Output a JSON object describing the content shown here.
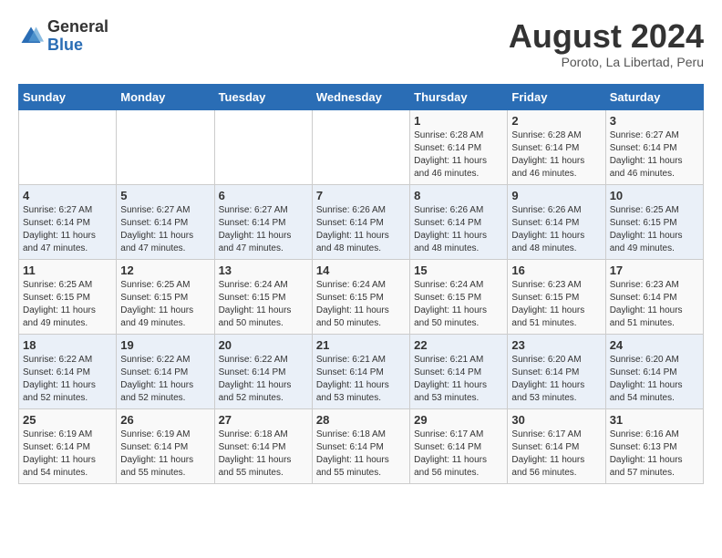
{
  "logo": {
    "text_general": "General",
    "text_blue": "Blue"
  },
  "title": "August 2024",
  "subtitle": "Poroto, La Libertad, Peru",
  "days_of_week": [
    "Sunday",
    "Monday",
    "Tuesday",
    "Wednesday",
    "Thursday",
    "Friday",
    "Saturday"
  ],
  "weeks": [
    [
      {
        "day": "",
        "info": ""
      },
      {
        "day": "",
        "info": ""
      },
      {
        "day": "",
        "info": ""
      },
      {
        "day": "",
        "info": ""
      },
      {
        "day": "1",
        "info": "Sunrise: 6:28 AM\nSunset: 6:14 PM\nDaylight: 11 hours\nand 46 minutes."
      },
      {
        "day": "2",
        "info": "Sunrise: 6:28 AM\nSunset: 6:14 PM\nDaylight: 11 hours\nand 46 minutes."
      },
      {
        "day": "3",
        "info": "Sunrise: 6:27 AM\nSunset: 6:14 PM\nDaylight: 11 hours\nand 46 minutes."
      }
    ],
    [
      {
        "day": "4",
        "info": "Sunrise: 6:27 AM\nSunset: 6:14 PM\nDaylight: 11 hours\nand 47 minutes."
      },
      {
        "day": "5",
        "info": "Sunrise: 6:27 AM\nSunset: 6:14 PM\nDaylight: 11 hours\nand 47 minutes."
      },
      {
        "day": "6",
        "info": "Sunrise: 6:27 AM\nSunset: 6:14 PM\nDaylight: 11 hours\nand 47 minutes."
      },
      {
        "day": "7",
        "info": "Sunrise: 6:26 AM\nSunset: 6:14 PM\nDaylight: 11 hours\nand 48 minutes."
      },
      {
        "day": "8",
        "info": "Sunrise: 6:26 AM\nSunset: 6:14 PM\nDaylight: 11 hours\nand 48 minutes."
      },
      {
        "day": "9",
        "info": "Sunrise: 6:26 AM\nSunset: 6:14 PM\nDaylight: 11 hours\nand 48 minutes."
      },
      {
        "day": "10",
        "info": "Sunrise: 6:25 AM\nSunset: 6:15 PM\nDaylight: 11 hours\nand 49 minutes."
      }
    ],
    [
      {
        "day": "11",
        "info": "Sunrise: 6:25 AM\nSunset: 6:15 PM\nDaylight: 11 hours\nand 49 minutes."
      },
      {
        "day": "12",
        "info": "Sunrise: 6:25 AM\nSunset: 6:15 PM\nDaylight: 11 hours\nand 49 minutes."
      },
      {
        "day": "13",
        "info": "Sunrise: 6:24 AM\nSunset: 6:15 PM\nDaylight: 11 hours\nand 50 minutes."
      },
      {
        "day": "14",
        "info": "Sunrise: 6:24 AM\nSunset: 6:15 PM\nDaylight: 11 hours\nand 50 minutes."
      },
      {
        "day": "15",
        "info": "Sunrise: 6:24 AM\nSunset: 6:15 PM\nDaylight: 11 hours\nand 50 minutes."
      },
      {
        "day": "16",
        "info": "Sunrise: 6:23 AM\nSunset: 6:15 PM\nDaylight: 11 hours\nand 51 minutes."
      },
      {
        "day": "17",
        "info": "Sunrise: 6:23 AM\nSunset: 6:14 PM\nDaylight: 11 hours\nand 51 minutes."
      }
    ],
    [
      {
        "day": "18",
        "info": "Sunrise: 6:22 AM\nSunset: 6:14 PM\nDaylight: 11 hours\nand 52 minutes."
      },
      {
        "day": "19",
        "info": "Sunrise: 6:22 AM\nSunset: 6:14 PM\nDaylight: 11 hours\nand 52 minutes."
      },
      {
        "day": "20",
        "info": "Sunrise: 6:22 AM\nSunset: 6:14 PM\nDaylight: 11 hours\nand 52 minutes."
      },
      {
        "day": "21",
        "info": "Sunrise: 6:21 AM\nSunset: 6:14 PM\nDaylight: 11 hours\nand 53 minutes."
      },
      {
        "day": "22",
        "info": "Sunrise: 6:21 AM\nSunset: 6:14 PM\nDaylight: 11 hours\nand 53 minutes."
      },
      {
        "day": "23",
        "info": "Sunrise: 6:20 AM\nSunset: 6:14 PM\nDaylight: 11 hours\nand 53 minutes."
      },
      {
        "day": "24",
        "info": "Sunrise: 6:20 AM\nSunset: 6:14 PM\nDaylight: 11 hours\nand 54 minutes."
      }
    ],
    [
      {
        "day": "25",
        "info": "Sunrise: 6:19 AM\nSunset: 6:14 PM\nDaylight: 11 hours\nand 54 minutes."
      },
      {
        "day": "26",
        "info": "Sunrise: 6:19 AM\nSunset: 6:14 PM\nDaylight: 11 hours\nand 55 minutes."
      },
      {
        "day": "27",
        "info": "Sunrise: 6:18 AM\nSunset: 6:14 PM\nDaylight: 11 hours\nand 55 minutes."
      },
      {
        "day": "28",
        "info": "Sunrise: 6:18 AM\nSunset: 6:14 PM\nDaylight: 11 hours\nand 55 minutes."
      },
      {
        "day": "29",
        "info": "Sunrise: 6:17 AM\nSunset: 6:14 PM\nDaylight: 11 hours\nand 56 minutes."
      },
      {
        "day": "30",
        "info": "Sunrise: 6:17 AM\nSunset: 6:14 PM\nDaylight: 11 hours\nand 56 minutes."
      },
      {
        "day": "31",
        "info": "Sunrise: 6:16 AM\nSunset: 6:13 PM\nDaylight: 11 hours\nand 57 minutes."
      }
    ]
  ]
}
